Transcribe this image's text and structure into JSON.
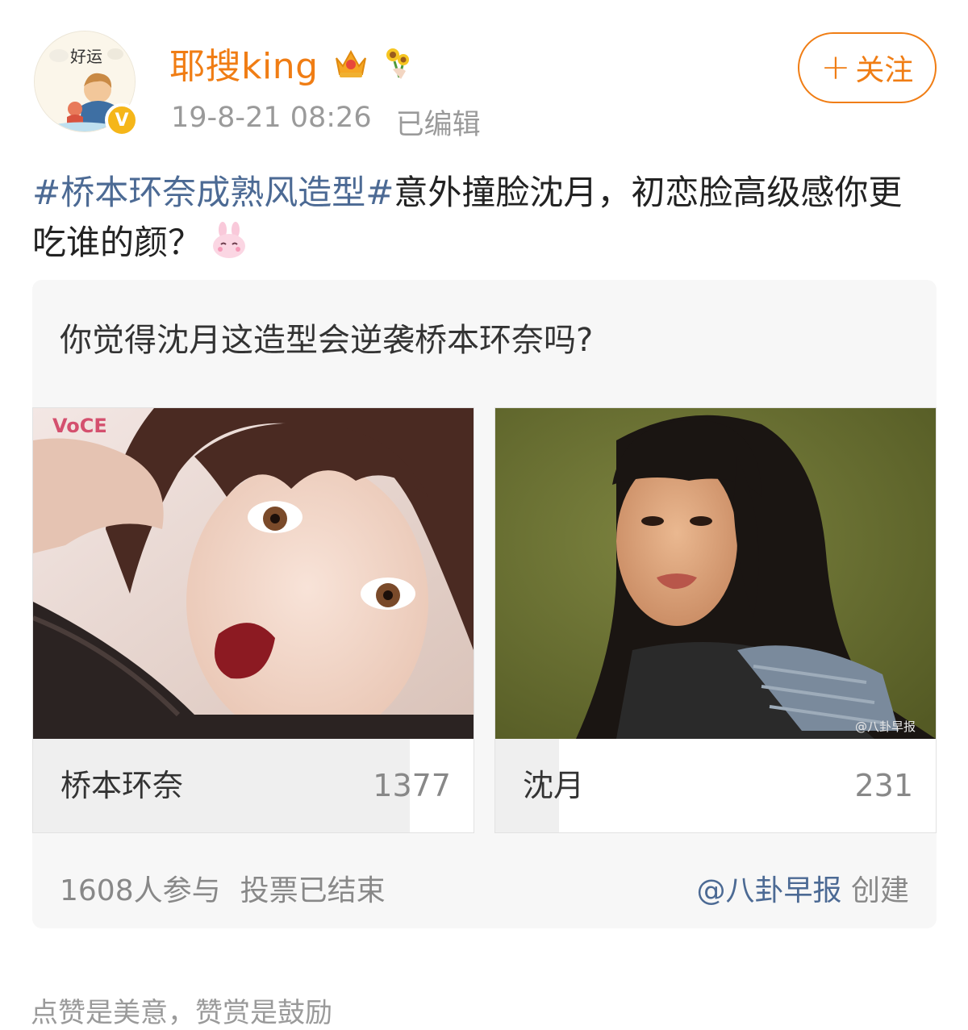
{
  "header": {
    "username": "耶搜king",
    "timestamp": "19-8-21 08:26",
    "edited": "已编辑",
    "follow_label": "关注",
    "avatar_caption": "好运",
    "icons": [
      "avatar-image",
      "verified-badge-icon",
      "crown-icon",
      "sunflower-icon",
      "plus-icon"
    ]
  },
  "post": {
    "hashtag": "#桥本环奈成熟风造型#",
    "text": "意外撞脸沈月，初恋脸高级感你更吃谁的颜？",
    "emoji": "bunny-emoji"
  },
  "vote": {
    "question": "你觉得沈月这造型会逆袭桥本环奈吗?",
    "options": [
      {
        "label": "桥本环奈",
        "count": "1377",
        "share": 0.856,
        "photo_watermark": "VoCE"
      },
      {
        "label": "沈月",
        "count": "231",
        "share": 0.144,
        "photo_watermark": "@八卦早报"
      }
    ],
    "participants": "1608人参与",
    "status": "投票已结束",
    "creator": "@八卦早报",
    "created_suffix": "创建"
  },
  "footer": {
    "note": "点赞是美意，赞赏是鼓励"
  },
  "colors": {
    "accent_orange": "#f07d14",
    "hashtag_blue": "#4c6a94",
    "verified_yellow": "#f5b619",
    "bar_fill": "#efefef"
  }
}
